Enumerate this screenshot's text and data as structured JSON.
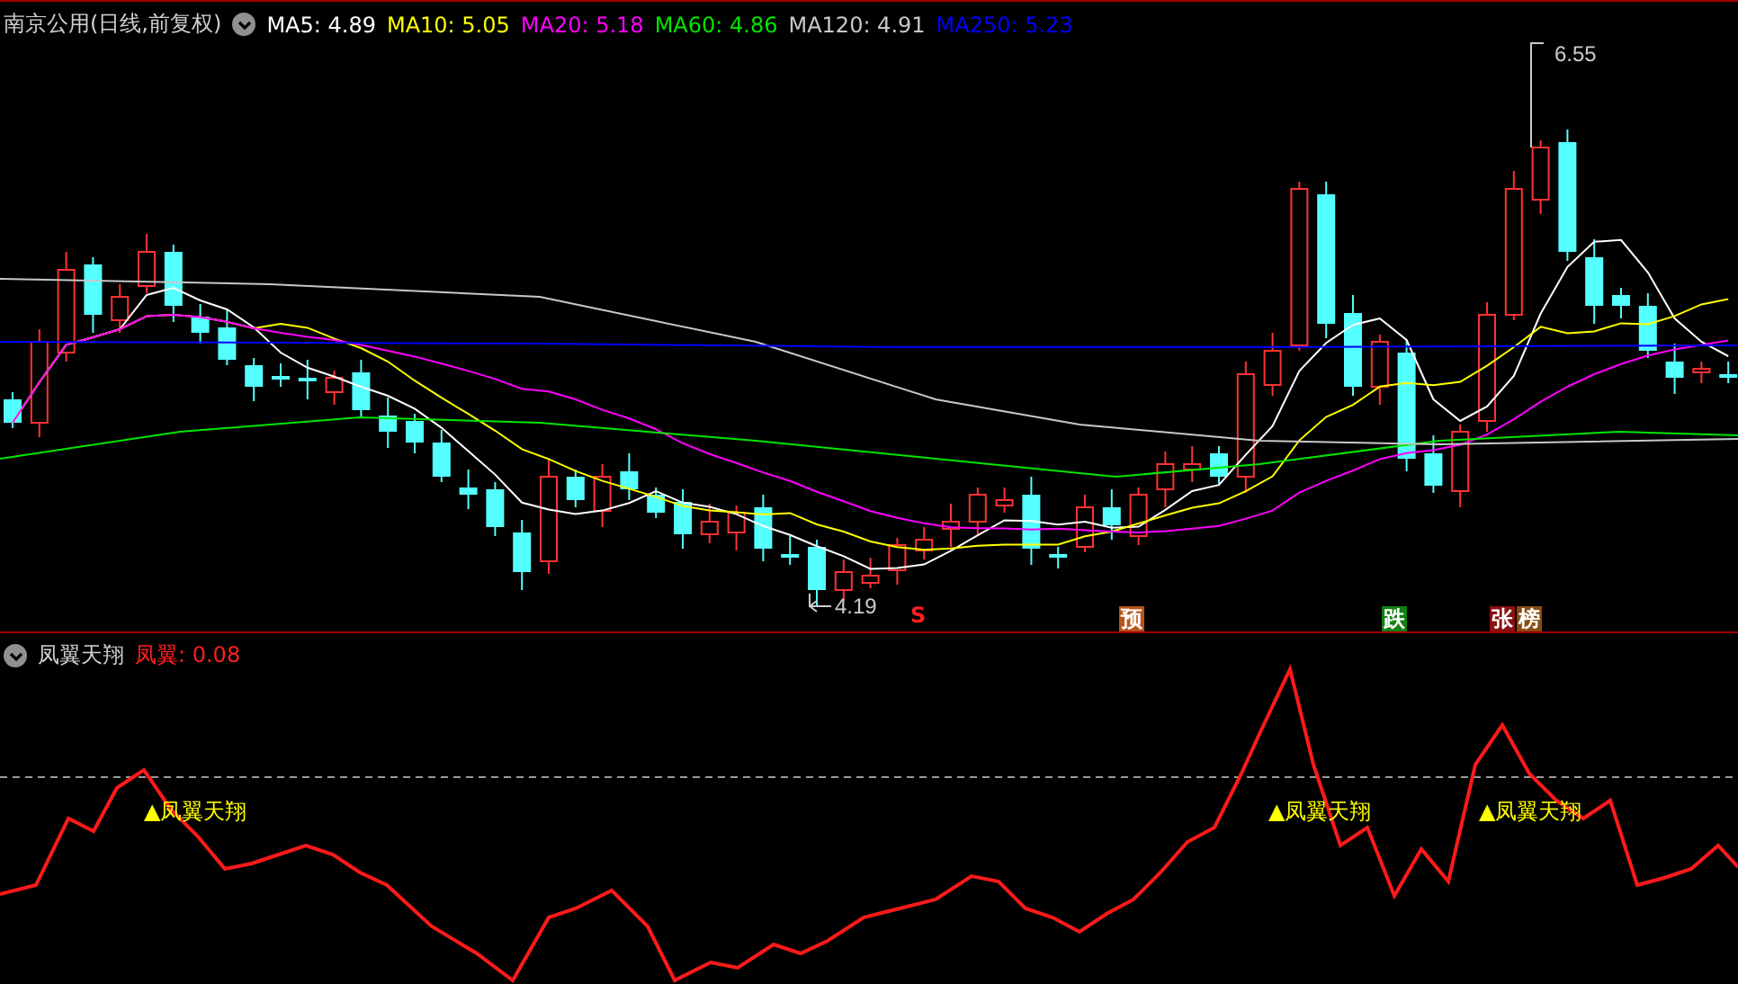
{
  "main_chart": {
    "title": "南京公用(日线,前复权)",
    "ma_legend": [
      {
        "label": "MA5: 4.89",
        "color": "#ffffff"
      },
      {
        "label": "MA10: 5.05",
        "color": "#ffff00"
      },
      {
        "label": "MA20: 5.18",
        "color": "#ff00ff"
      },
      {
        "label": "MA60: 4.86",
        "color": "#00e600"
      },
      {
        "label": "MA120: 4.91",
        "color": "#c8c8c8"
      },
      {
        "label": "MA250: 5.23",
        "color": "#0000ff"
      }
    ],
    "high_label": "6.55",
    "low_label": "4.19",
    "signals": [
      {
        "text": "S",
        "kind": "sell",
        "color": "#ff2020"
      },
      {
        "text": "预",
        "kind": "badge",
        "color": "#b85418"
      },
      {
        "text": "跌",
        "kind": "badge",
        "color": "#128012"
      },
      {
        "text": "张",
        "kind": "badge",
        "color": "#8a1010"
      },
      {
        "text": "榜",
        "kind": "badge",
        "color": "#8a4a10"
      }
    ]
  },
  "indicator": {
    "title": "凤翼天翔",
    "value": "凤翼: 0.08",
    "signal_labels": [
      "▲凤翼天翔",
      "▲凤翼天翔",
      "▲凤翼天翔"
    ]
  }
}
